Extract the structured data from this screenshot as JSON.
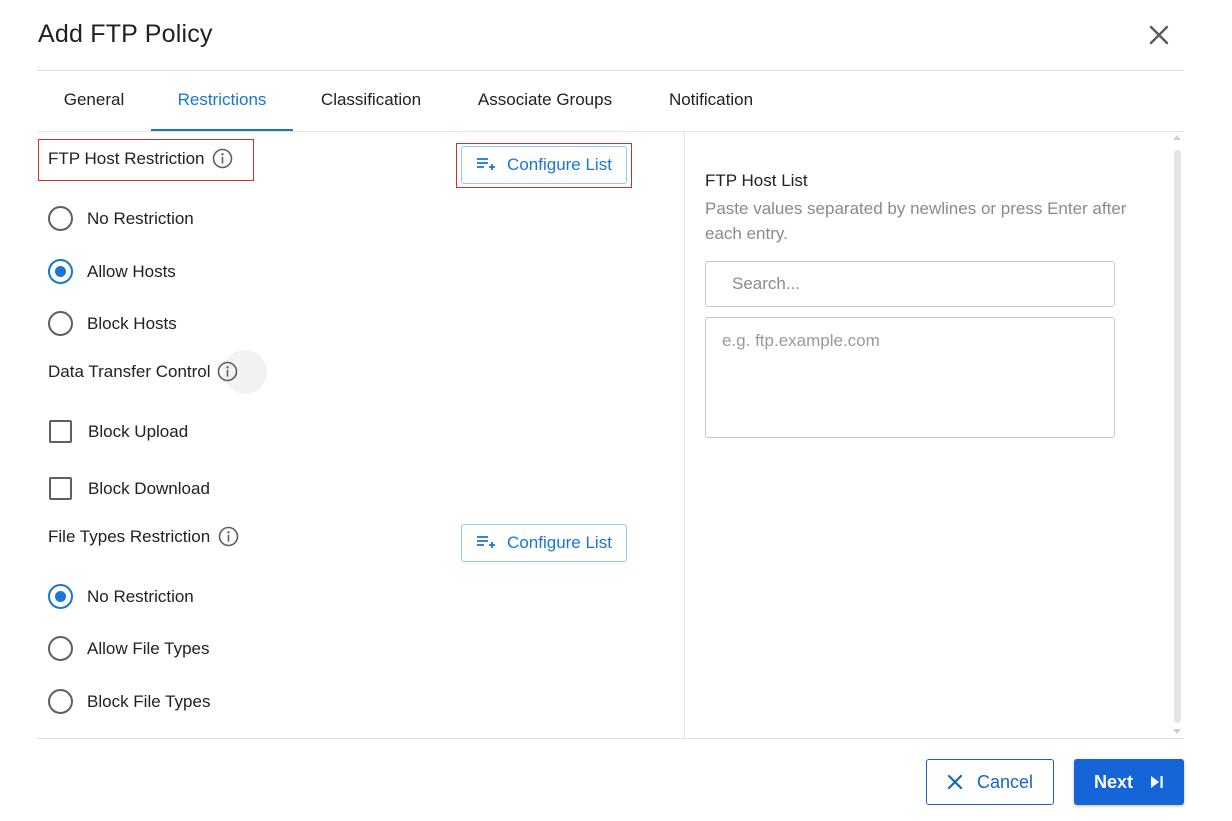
{
  "dialog": {
    "title": "Add FTP Policy"
  },
  "tabs": [
    {
      "label": "General",
      "active": false
    },
    {
      "label": "Restrictions",
      "active": true
    },
    {
      "label": "Classification",
      "active": false
    },
    {
      "label": "Associate Groups",
      "active": false
    },
    {
      "label": "Notification",
      "active": false
    }
  ],
  "ftp_host": {
    "label": "FTP Host Restriction",
    "configure_label": "Configure List",
    "options": [
      {
        "label": "No Restriction",
        "selected": false
      },
      {
        "label": "Allow Hosts",
        "selected": true
      },
      {
        "label": "Block Hosts",
        "selected": false
      }
    ]
  },
  "data_transfer": {
    "label": "Data Transfer Control",
    "options": [
      {
        "label": "Block Upload",
        "checked": false
      },
      {
        "label": "Block Download",
        "checked": false
      }
    ]
  },
  "file_types": {
    "label": "File Types Restriction",
    "configure_label": "Configure List",
    "options": [
      {
        "label": "No Restriction",
        "selected": true
      },
      {
        "label": "Allow File Types",
        "selected": false
      },
      {
        "label": "Block File Types",
        "selected": false
      }
    ]
  },
  "host_list": {
    "title": "FTP Host List",
    "hint": "Paste values separated by newlines or press Enter after each entry.",
    "search_placeholder": "Search...",
    "entry_placeholder": "e.g. ftp.example.com",
    "search_value": "",
    "entry_value": ""
  },
  "footer": {
    "cancel_label": "Cancel",
    "next_label": "Next"
  },
  "colors": {
    "accent": "#1976d2",
    "primary_button": "#1565d8",
    "highlight_border": "#d32f2f"
  },
  "icons": [
    "close-icon",
    "info-icon",
    "playlist-add-icon",
    "cancel-x-icon",
    "skip-next-icon"
  ]
}
